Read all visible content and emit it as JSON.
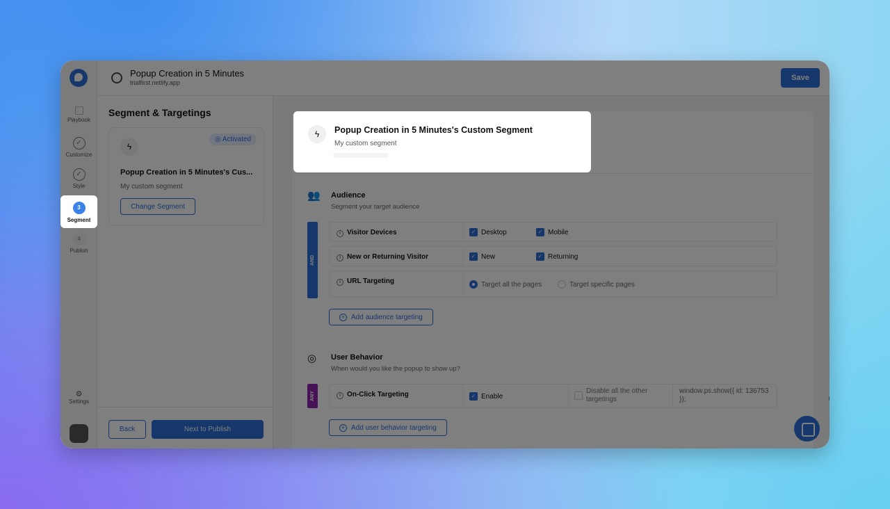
{
  "header": {
    "title": "Popup Creation in 5 Minutes",
    "subtitle": "trialfirst.netlify.app",
    "save_label": "Save"
  },
  "sidebar": {
    "items": [
      {
        "label": "Playbook",
        "icon": "grid-icon"
      },
      {
        "label": "Customize",
        "icon": "check-circle-icon"
      },
      {
        "label": "Style",
        "icon": "check-circle-icon"
      },
      {
        "label": "Segment",
        "step": "3",
        "active": true
      },
      {
        "label": "Publish",
        "step": "4"
      }
    ],
    "settings_label": "Settings"
  },
  "left": {
    "title": "Segment & Targetings",
    "badge": "Activated",
    "segment_name": "Popup Creation in 5 Minutes's Cus...",
    "segment_desc": "My custom segment",
    "change_label": "Change Segment",
    "back_label": "Back",
    "next_label": "Next to Publish"
  },
  "popover": {
    "title": "Popup Creation in 5 Minutes's Custom Segment",
    "subtitle": "My custom segment"
  },
  "audience": {
    "title": "Audience",
    "subtitle": "Segment your target audience",
    "operator": "AND",
    "rows": [
      {
        "label": "Visitor Devices",
        "options": [
          {
            "label": "Desktop",
            "checked": true
          },
          {
            "label": "Mobile",
            "checked": true
          }
        ]
      },
      {
        "label": "New or Returning Visitor",
        "options": [
          {
            "label": "New",
            "checked": true
          },
          {
            "label": "Returning",
            "checked": true
          }
        ]
      },
      {
        "label": "URL Targeting",
        "options": [
          {
            "label": "Target all the pages",
            "selected": true
          },
          {
            "label": "Target specific pages",
            "selected": false
          }
        ]
      }
    ],
    "add_label": "Add audience targeting"
  },
  "behavior": {
    "title": "User Behavior",
    "subtitle": "When would you like the popup to show up?",
    "operator": "ANY",
    "row": {
      "label": "On-Click Targeting",
      "enable_label": "Enable",
      "enable_checked": true,
      "disable_label": "Disable all the other targetings",
      "disable_checked": false,
      "code": "window.ps.show({ id: 136753 });"
    },
    "add_label": "Add user behavior targeting"
  },
  "colors": {
    "accent": "#2d6fd8",
    "and_operator": "#2d6fd8",
    "any_operator": "#8e24aa"
  }
}
